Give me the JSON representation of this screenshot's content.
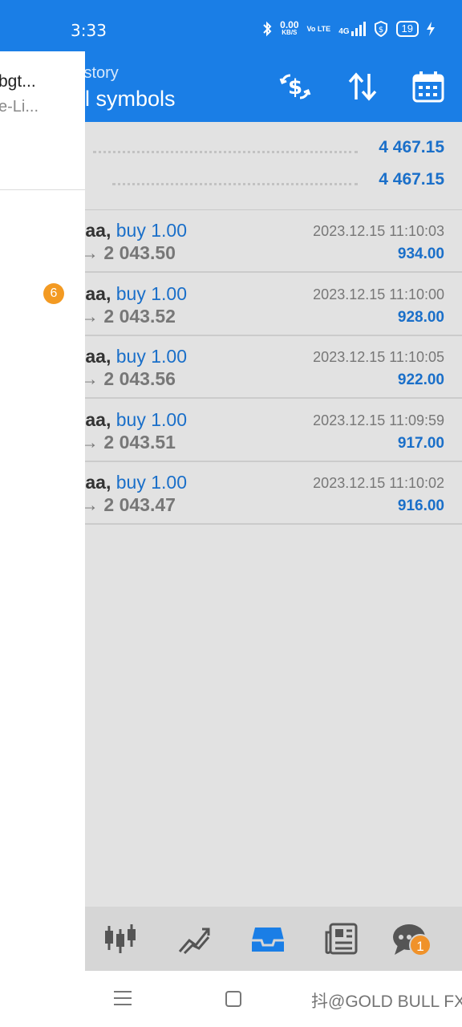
{
  "status_bar": {
    "time": "3:33",
    "net_speed": "0.00",
    "net_unit": "KB/S",
    "volte": "Vo LTE",
    "network": "4G",
    "battery": "19"
  },
  "header": {
    "subtitle": "istory",
    "title": "ll symbols",
    "buttons": [
      "currency-exchange-icon",
      "sort-icon",
      "calendar-icon"
    ]
  },
  "summary": {
    "rows": [
      {
        "label": "",
        "value": "4 467.15"
      },
      {
        "label": ":",
        "value": "4 467.15"
      }
    ]
  },
  "trades": [
    {
      "symbol": ".aa,",
      "type": "buy 1.00",
      "open_price": "",
      "close_price": "→ 2 043.50",
      "time": "2023.12.15 11:10:03",
      "profit": "934.00"
    },
    {
      "symbol": ".aa,",
      "type": "buy 1.00",
      "open_price": "",
      "close_price": "→ 2 043.52",
      "time": "2023.12.15 11:10:00",
      "profit": "928.00"
    },
    {
      "symbol": ".aa,",
      "type": "buy 1.00",
      "open_price": "",
      "close_price": "→ 2 043.56",
      "time": "2023.12.15 11:10:05",
      "profit": "922.00"
    },
    {
      "symbol": ".aa,",
      "type": "buy 1.00",
      "open_price": "",
      "close_price": "→ 2 043.51",
      "time": "2023.12.15 11:09:59",
      "profit": "917.00"
    },
    {
      "symbol": ".aa,",
      "type": "buy 1.00",
      "open_price": "",
      "close_price": "→ 2 043.47",
      "time": "2023.12.15 11:10:02",
      "profit": "916.00"
    }
  ],
  "bottom_nav": {
    "items": [
      "quotes-icon",
      "chart-icon",
      "trade-icon",
      "news-icon",
      "chat-icon"
    ],
    "active": "trade-icon",
    "chat_badge": "1"
  },
  "drawer": {
    "title": "bgt...",
    "subtitle": "e-Li...",
    "badge": "6"
  },
  "system_nav": {
    "watermark": "抖@GOLD BULL FX"
  },
  "colors": {
    "primary": "#1a7ee6",
    "value_blue": "#1a6fc9",
    "badge_orange": "#f39a22"
  }
}
